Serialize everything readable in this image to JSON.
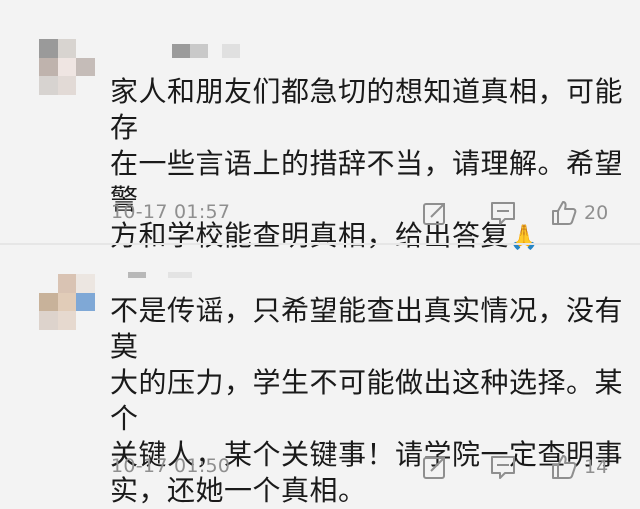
{
  "comments": [
    {
      "text": "家人和朋友们都急切的想知道真相，可能存\n在一些言语上的措辞不当，请理解。希望警\n方和学校能查明真相，给出答复",
      "emoji": "🙏",
      "time": "10-17 01:57",
      "likes": "20",
      "avatar_colors": [
        "#9a9a9a",
        "#d8d4d0",
        "#ffffff",
        "#bfb3ad",
        "#efe5e2",
        "#c5bcb8",
        "#d7d3d0",
        "#e2dad6",
        "#f2f2f2"
      ]
    },
    {
      "text": "不是传谣，只希望能查出真实情况，没有莫\n大的压力，学生不可能做出这种选择。某个\n关键人，某个关键事！请学院一定查明事\n实，还她一个真相。",
      "time": "10-17 01:50",
      "likes": "14",
      "avatar_colors": [
        "#c9b7a8",
        "#d9c3b3",
        "#ece6e1",
        "#c8b29a",
        "#e1ccb8",
        "#7fa8d6",
        "#ddd3cc",
        "#e6d9cf",
        "#f2f2f2"
      ]
    }
  ],
  "icons": {
    "share": "share-icon",
    "reply": "comment-icon",
    "like": "thumbs-up-icon"
  }
}
